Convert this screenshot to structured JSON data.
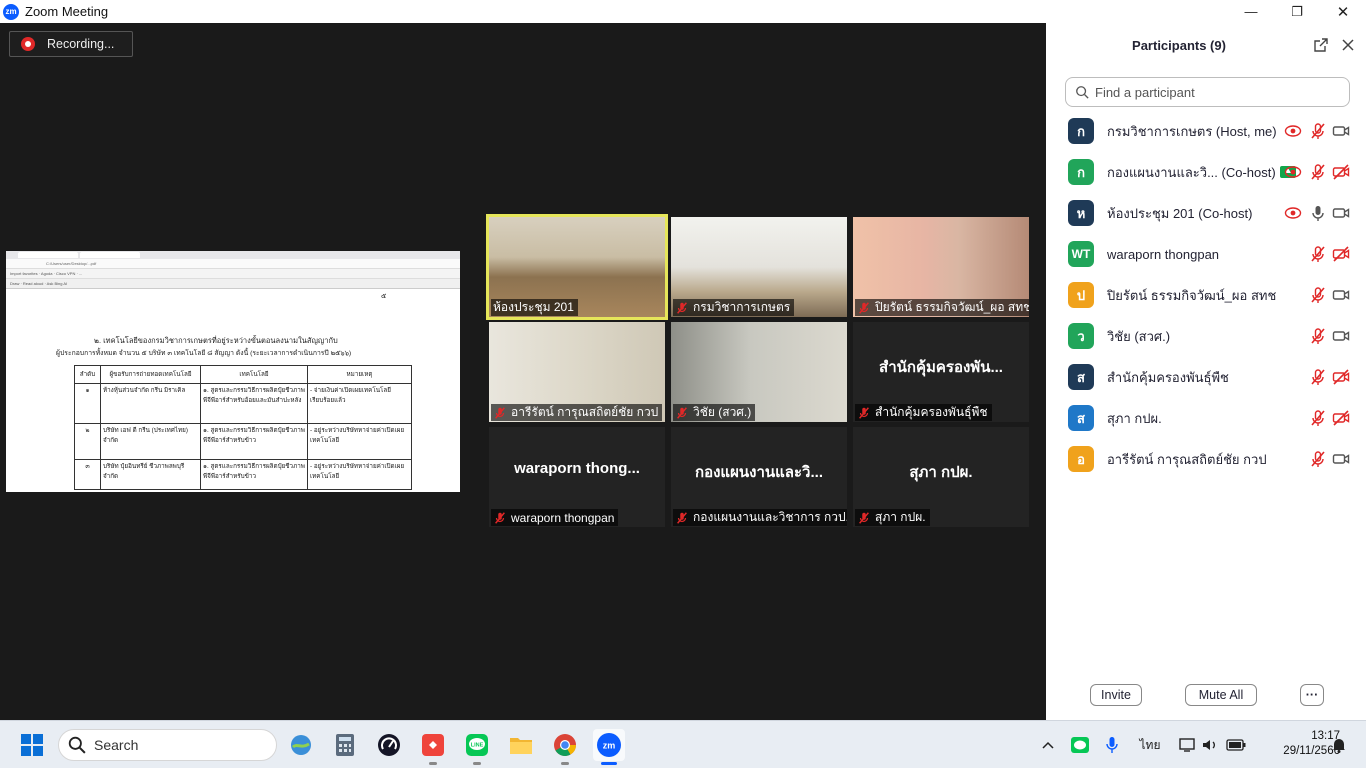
{
  "window": {
    "title": "Zoom Meeting",
    "minimize": "—",
    "restore": "❐",
    "close": "✕"
  },
  "meeting": {
    "recording_label": "Recording..."
  },
  "shared_doc": {
    "page_number": "๕",
    "heading_line1": "๒. เทคโนโลยีของกรมวิชาการเกษตรที่อยู่ระหว่างขั้นตอนลงนามในสัญญากับ",
    "heading_line2": "ผู้ประกอบการทั้งหมด จำนวน ๕ บริษัท ๓ เทคโนโลยี ๘ สัญญา ดังนี้ (ระยะเวลาการดำเนินการปี ๒๕๖๖)",
    "columns": [
      "ลำดับ",
      "ผู้ขอรับการถ่ายทอดเทคโนโลยี",
      "เทคโนโลยี",
      "หมายเหตุ"
    ],
    "rows": [
      [
        "๑",
        "ห้างหุ้นส่วนจำกัด กรีน มิราเคิล",
        "๑. สูตรและกรรมวิธีการผลิตปุ๋ยชีวภาพพีจีพีอาร์สำหรับอ้อยและมันสำปะหลัง",
        "- จ่ายเงินค่าเปิดเผยเทคโนโลยีเรียบร้อยแล้ว"
      ],
      [
        "๒",
        "บริษัท เอฟ ดี กรีน (ประเทศไทย) จำกัด",
        "๑. สูตรและกรรมวิธีการผลิตปุ๋ยชีวภาพพีจีพีอาร์สำหรับข้าว",
        "- อยู่ระหว่างบริษัทหาจ่ายค่าเปิดเผยเทคโนโลยี"
      ],
      [
        "๓",
        "บริษัท ปุ๋ยอินทรีย์ ชีวภาพลพบุรี จำกัด",
        "๑. สูตรและกรรมวิธีการผลิตปุ๋ยชีวภาพพีจีพีอาร์สำหรับข้าว",
        "- อยู่ระหว่างบริษัทหาจ่ายค่าเปิดเผยเทคโนโลยี"
      ]
    ]
  },
  "tiles": [
    {
      "name": "ห้องประชุม 201",
      "muted": false,
      "video": true
    },
    {
      "name": "กรมวิชาการเกษตร",
      "muted": true,
      "video": true
    },
    {
      "name": "ปิยรัตน์ ธรรมกิจวัฒน์_ผอ สทช",
      "muted": true,
      "video": true
    },
    {
      "name": "อารีรัตน์ การุณสถิตย์ชัย กวป",
      "muted": true,
      "video": true
    },
    {
      "name": "วิชัย (สวศ.)",
      "muted": true,
      "video": true
    },
    {
      "name": "สำนักคุ้มครองพันธุ์พืช",
      "big_name": "สำนักคุ้มครองพัน...",
      "muted": true,
      "video": false
    },
    {
      "name": "waraporn thongpan",
      "big_name": "waraporn  thong...",
      "muted": true,
      "video": false
    },
    {
      "name": "กองแผนงานและวิชาการ กวป.",
      "big_name": "กองแผนงานและวิ...",
      "muted": true,
      "video": false
    },
    {
      "name": "สุภา กปผ.",
      "big_name": "สุภา กปผ.",
      "muted": true,
      "video": false
    }
  ],
  "participants": {
    "title": "Participants (9)",
    "search_placeholder": "Find a participant",
    "list": [
      {
        "initial": "ก",
        "color": "#1f3a57",
        "name": "กรมวิชาการเกษตร (Host, me)",
        "recording": true,
        "audio": "muted",
        "video": "on"
      },
      {
        "initial": "ก",
        "color": "#21a55a",
        "name": "กองแผนงานและวิ... (Co-host)",
        "share_badge": true,
        "recording": true,
        "audio": "muted",
        "video": "off"
      },
      {
        "initial": "ห",
        "color": "#1f3a57",
        "name": "ห้องประชุม 201 (Co-host)",
        "recording": true,
        "audio": "on",
        "video": "on"
      },
      {
        "initial": "WT",
        "color": "#21a55a",
        "name": "waraporn thongpan",
        "recording": false,
        "audio": "muted",
        "video": "off"
      },
      {
        "initial": "ป",
        "color": "#f0a21c",
        "name": "ปิยรัตน์ ธรรมกิจวัฒน์_ผอ สทช",
        "recording": false,
        "audio": "muted",
        "video": "on"
      },
      {
        "initial": "ว",
        "color": "#21a55a",
        "name": "วิชัย (สวศ.)",
        "recording": false,
        "audio": "muted",
        "video": "on"
      },
      {
        "initial": "ส",
        "color": "#1f3a57",
        "name": "สำนักคุ้มครองพันธุ์พืช",
        "recording": false,
        "audio": "muted",
        "video": "off"
      },
      {
        "initial": "ส",
        "color": "#1f78c8",
        "name": "สุภา กปผ.",
        "recording": false,
        "audio": "muted",
        "video": "off"
      },
      {
        "initial": "อ",
        "color": "#f0a21c",
        "name": "อารีรัตน์ การุณสถิตย์ชัย กวป",
        "recording": false,
        "audio": "muted",
        "video": "on"
      }
    ],
    "invite_label": "Invite",
    "mute_all_label": "Mute All",
    "more_label": "···"
  },
  "taskbar": {
    "search_label": "Search",
    "language": "ไทย",
    "time": "13:17",
    "date": "29/11/2566",
    "apps": [
      "widgets-icon",
      "calculator-icon",
      "speedtest-icon",
      "anydesk-icon",
      "line-icon",
      "file-explorer-icon",
      "chrome-icon",
      "zoom-icon"
    ]
  },
  "colors": {
    "accent": "#0b5cff",
    "muted_red": "#e02828",
    "active_speaker": "#e6e65a"
  }
}
